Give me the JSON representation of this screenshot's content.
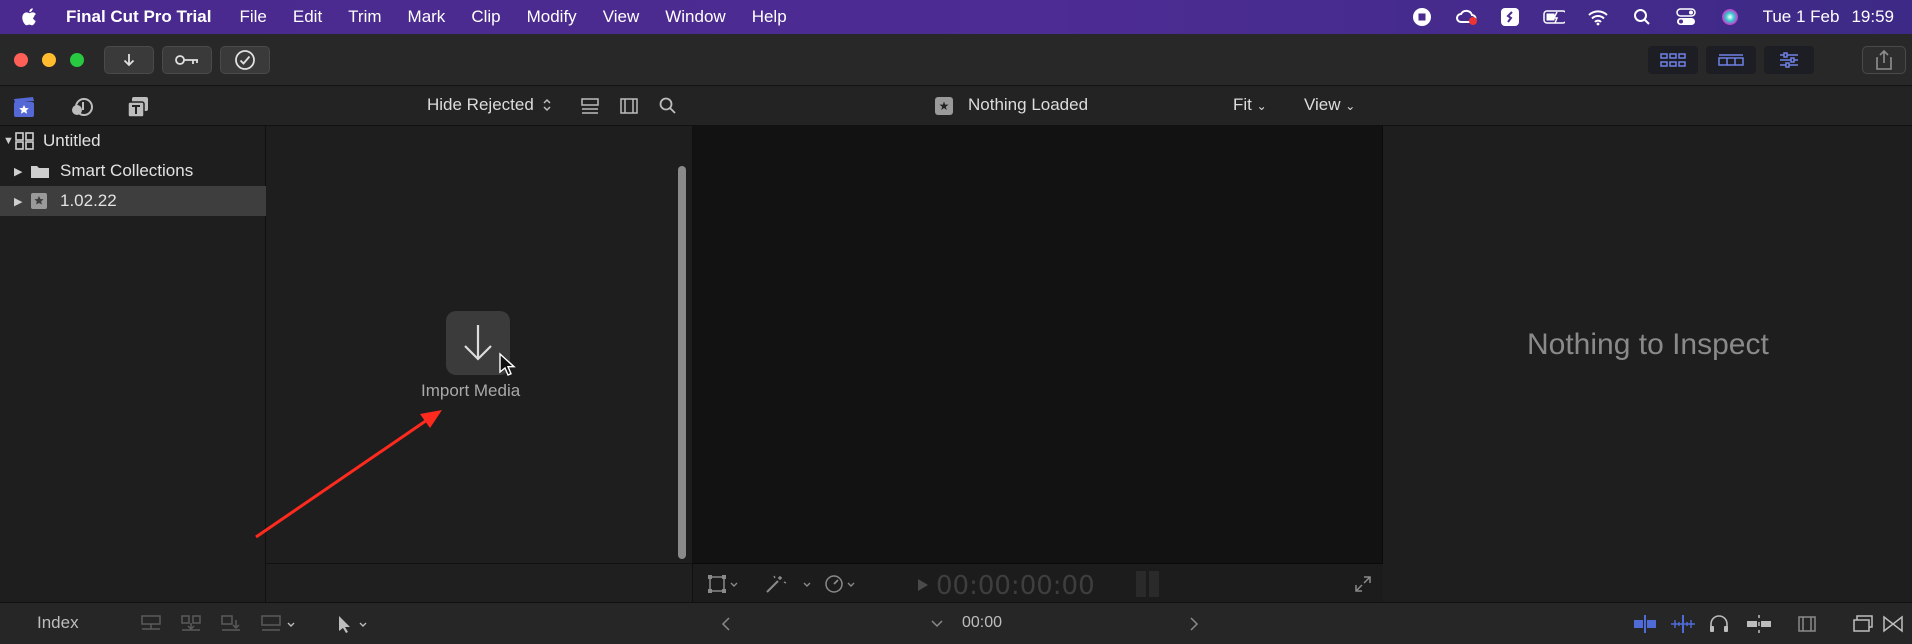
{
  "menubar": {
    "app_name": "Final Cut Pro Trial",
    "items": [
      "File",
      "Edit",
      "Trim",
      "Mark",
      "Clip",
      "Modify",
      "View",
      "Window",
      "Help"
    ],
    "date": "Tue 1 Feb",
    "time": "19:59"
  },
  "colors": {
    "menubar_gradient": "#4a2a8e",
    "traffic_red": "#ff5f57",
    "traffic_yellow": "#febc2e",
    "traffic_green": "#28c840",
    "accent_blue": "#4f6bd8",
    "annotation_red": "#ff2a1e"
  },
  "browser": {
    "filter_label": "Hide Rejected",
    "import_label": "Import Media"
  },
  "libraries": [
    {
      "label": "Untitled",
      "icon": "library-grid-icon"
    },
    {
      "label": "Smart Collections",
      "icon": "folder-icon"
    },
    {
      "label": "1.02.22",
      "icon": "event-star-icon"
    }
  ],
  "viewer": {
    "title": "Nothing Loaded",
    "fit_label": "Fit",
    "view_label": "View",
    "timecode": "00:00:00:00"
  },
  "inspector": {
    "empty_label": "Nothing to Inspect"
  },
  "bottombar": {
    "index_label": "Index",
    "timecode": "00:00"
  }
}
